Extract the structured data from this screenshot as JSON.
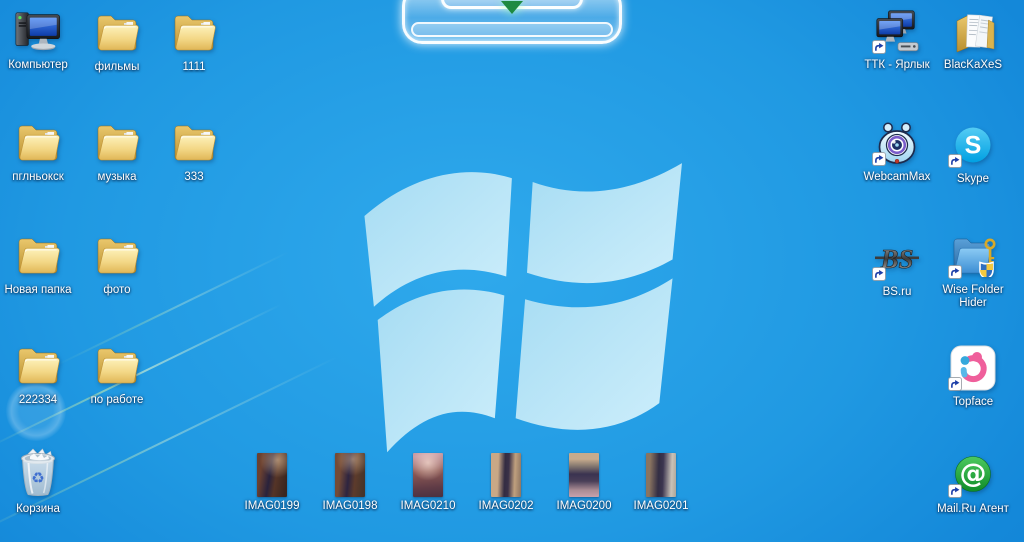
{
  "wallpaper": {
    "base_color": "#1e95de",
    "logo_color": "#b5e3f5",
    "description_colors": {
      "accent_green_arrow": "#1e8a41"
    }
  },
  "dock_widget": {
    "arrow_icon": "chevron-down-triangle"
  },
  "desktop": {
    "left_icons": [
      {
        "label": "Компьютер",
        "type": "computer"
      },
      {
        "label": "фильмы",
        "type": "folder"
      },
      {
        "label": "1111",
        "type": "folder"
      },
      {
        "label": "пглньокск",
        "type": "folder"
      },
      {
        "label": "музыка",
        "type": "folder"
      },
      {
        "label": "333",
        "type": "folder"
      },
      {
        "label": "Новая папка",
        "type": "folder"
      },
      {
        "label": "фото",
        "type": "folder"
      },
      {
        "label": "222334",
        "type": "folder"
      },
      {
        "label": "по работе",
        "type": "folder"
      },
      {
        "label": "Корзина",
        "type": "recycle-bin-full"
      }
    ],
    "right_icons": [
      {
        "label": "ТТК - Ярлык",
        "type": "network-shortcut"
      },
      {
        "label": "BlacKaXeS",
        "type": "open-folder-with-documents"
      },
      {
        "label": "WebcamMax",
        "type": "webcam-app-shortcut"
      },
      {
        "label": "Skype",
        "type": "skype-shortcut"
      },
      {
        "label": "BS.ru",
        "type": "bs-logo-shortcut"
      },
      {
        "label": "Wise Folder Hider",
        "type": "blue-folder-key-shield-shortcut"
      },
      {
        "label": "Topface",
        "type": "topface-app-shortcut"
      },
      {
        "label": "Mail.Ru Агент",
        "type": "mailru-agent-shortcut"
      }
    ],
    "photo_icons": [
      {
        "label": "IMAG0199"
      },
      {
        "label": "IMAG0198"
      },
      {
        "label": "IMAG0210"
      },
      {
        "label": "IMAG0202"
      },
      {
        "label": "IMAG0200"
      },
      {
        "label": "IMAG0201"
      }
    ]
  }
}
